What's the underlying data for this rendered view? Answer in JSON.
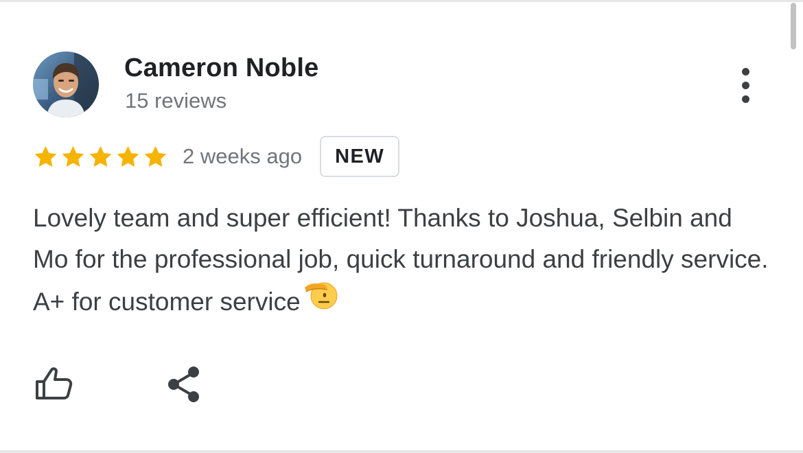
{
  "review": {
    "reviewer_name": "Cameron Noble",
    "review_count": "15 reviews",
    "rating": 5,
    "rating_max": 5,
    "timestamp": "2 weeks ago",
    "badge": "NEW",
    "text": "Lovely team and super efficient! Thanks to Joshua, Selbin and Mo for the professional job, quick turnaround and friendly service. A+ for customer service",
    "emoji": "saluting-face"
  },
  "icons": {
    "more": "more-vert-icon",
    "like": "thumbs-up-icon",
    "share": "share-icon"
  },
  "colors": {
    "star": "#f4b400",
    "name": "#202124",
    "secondary": "#70757a",
    "body": "#3c4043"
  }
}
